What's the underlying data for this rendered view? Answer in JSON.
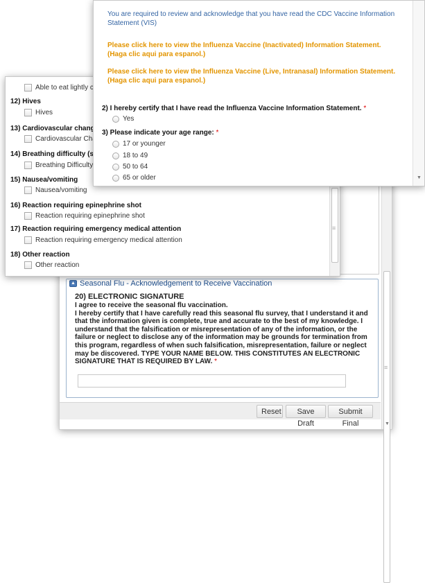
{
  "top_window": {
    "intro": "You are required to review and acknowledge that you have read the CDC Vaccine Information Statement (VIS)",
    "link_inactivated": "Please click here to view the Influenza Vaccine (Inactivated) Information Statement. (Haga clic aqui para espanol.)",
    "link_live": "Please click here to view the Influenza Vaccine (Live, Intranasal) Information Statement. (Haga clic aqui para espanol.)",
    "q2": {
      "label": "2) I hereby certify that I have read the Influenza Vaccine Information Statement.",
      "required": "*",
      "option_yes": "Yes"
    },
    "q3": {
      "label": "3) Please indicate your age range:",
      "required": "*",
      "options": [
        "17 or younger",
        "18 to 49",
        "50 to 64",
        "65 or older"
      ]
    }
  },
  "middle_window": {
    "item_partial": "Able to eat lightly co",
    "q12": {
      "label": "12) Hives",
      "option": "Hives"
    },
    "q13": {
      "label": "13) Cardiovascular chang",
      "option": "Cardiovascular Cha"
    },
    "q14": {
      "label": "14) Breathing difficulty (s",
      "option": "Breathing Difficulty ("
    },
    "q15": {
      "label": "15) Nausea/vomiting",
      "option": "Nausea/vomiting"
    },
    "q16": {
      "label": "16) Reaction requiring epinephrine shot",
      "option": "Reaction requiring epinephrine shot"
    },
    "q17": {
      "label": "17) Reaction requiring emergency medical attention",
      "option": "Reaction requiring emergency medical attention"
    },
    "q18": {
      "label": "18) Other reaction",
      "option": "Other reaction"
    }
  },
  "back_window": {
    "section_title": "Seasonal Flu - Acknowledgement to Receive Vaccination",
    "q20_title": "20) ELECTRONIC SIGNATURE",
    "q20_line1": "I agree to receive the seasonal flu vaccination.",
    "q20_body": "I hereby certify that I have carefully read this seasonal flu survey, that I understand it and that the information given is complete, true and accurate to the best of my knowledge. I understand that the falsification or misrepresentation of any of the information, or the failure or neglect to disclose any of the information may be grounds for termination from this program, regardless of when such falsification, misrepresentation, failure or neglect may be discovered. TYPE YOUR NAME BELOW. THIS CONSTITUTES AN ELECTRONIC SIGNATURE THAT IS REQUIRED BY LAW.",
    "q20_required": "*",
    "signature_value": "",
    "buttons": {
      "reset": "Reset",
      "save_draft": "Save Draft",
      "submit_final": "Submit Final"
    }
  }
}
